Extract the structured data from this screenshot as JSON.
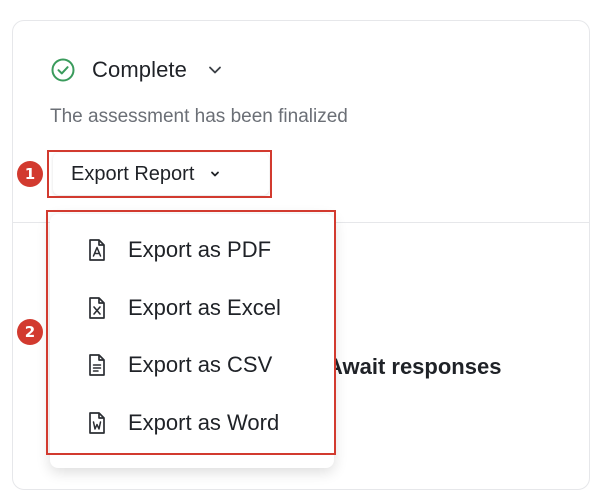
{
  "status": {
    "label": "Complete",
    "description": "The assessment has been finalized",
    "icon": "check-circle-icon",
    "color": "#3a9b5c"
  },
  "export_button": {
    "label": "Export Report",
    "icon": "chevron-down-icon"
  },
  "export_menu": {
    "items": [
      {
        "label": "Export as PDF",
        "icon": "pdf-file-icon"
      },
      {
        "label": "Export as Excel",
        "icon": "excel-file-icon"
      },
      {
        "label": "Export as CSV",
        "icon": "csv-file-icon"
      },
      {
        "label": "Export as Word",
        "icon": "word-file-icon"
      }
    ]
  },
  "background_text": "Await responses",
  "annotations": {
    "badge_1": "1",
    "badge_2": "2",
    "color": "#d23a2f"
  }
}
